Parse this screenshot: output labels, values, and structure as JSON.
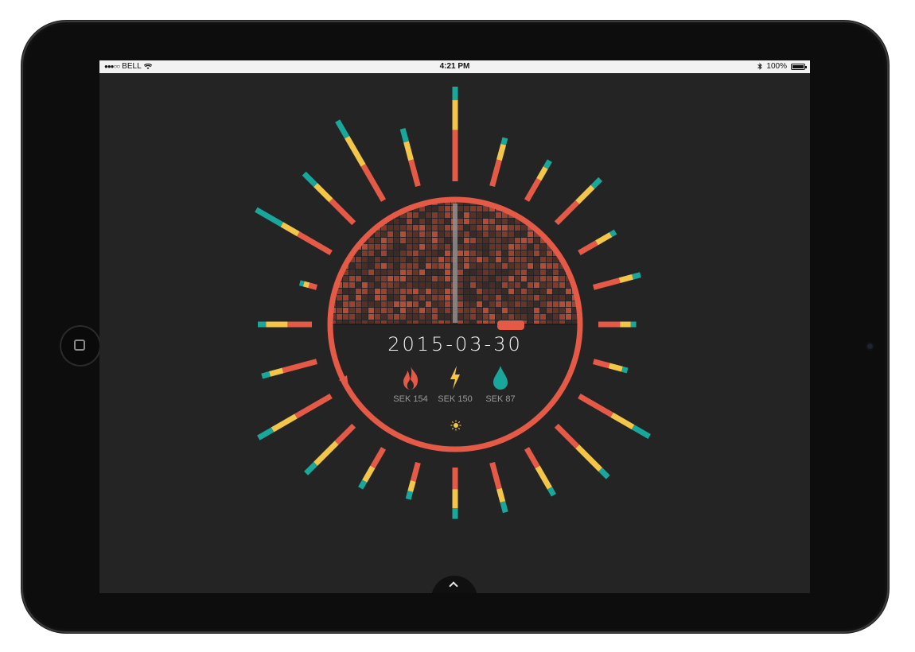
{
  "status_bar": {
    "signal": "●●●○○",
    "carrier": "BELL",
    "time": "4:21 PM",
    "battery": "100%"
  },
  "dashboard": {
    "date": "2015-03-30",
    "stats": [
      {
        "icon": "flame-icon",
        "label": "SEK 154",
        "color": "#e45a46"
      },
      {
        "icon": "lightning-icon",
        "label": "SEK 150",
        "color": "#f3c64a"
      },
      {
        "icon": "water-drop-icon",
        "label": "SEK 87",
        "color": "#1aa79b"
      }
    ],
    "weather_icon": "sun-icon"
  },
  "colors": {
    "ring": "#e45a46",
    "orange": "#e45a46",
    "yellow": "#f3c64a",
    "teal": "#1aa79b",
    "background": "#242424"
  },
  "chart_data": {
    "type": "radial",
    "segments_per_bar": [
      "orange",
      "yellow",
      "teal"
    ],
    "bars": [
      [
        38,
        22,
        10
      ],
      [
        20,
        12,
        5
      ],
      [
        18,
        10,
        6
      ],
      [
        22,
        16,
        8
      ],
      [
        15,
        12,
        4
      ],
      [
        20,
        10,
        6
      ],
      [
        16,
        8,
        4
      ],
      [
        12,
        10,
        4
      ],
      [
        28,
        18,
        14
      ],
      [
        22,
        24,
        8
      ],
      [
        16,
        18,
        6
      ],
      [
        20,
        10,
        8
      ],
      [
        16,
        14,
        8
      ],
      [
        14,
        8,
        6
      ],
      [
        16,
        12,
        6
      ],
      [
        18,
        22,
        10
      ],
      [
        30,
        20,
        12
      ],
      [
        26,
        10,
        6
      ],
      [
        18,
        16,
        6
      ],
      [
        6,
        4,
        3
      ],
      [
        28,
        14,
        22
      ],
      [
        24,
        16,
        12
      ],
      [
        30,
        24,
        14
      ],
      [
        20,
        14,
        10
      ]
    ]
  }
}
